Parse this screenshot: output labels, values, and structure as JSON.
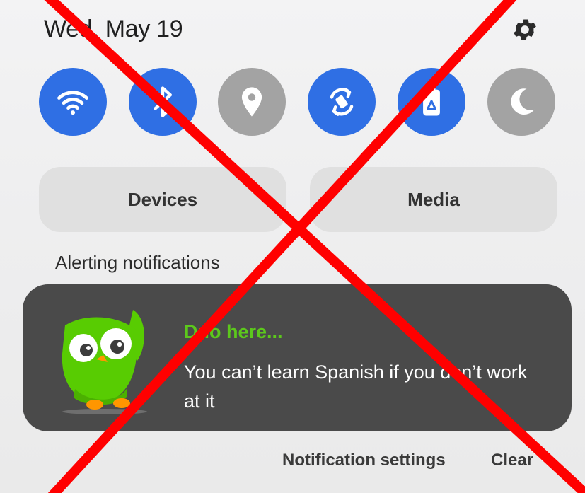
{
  "status": {
    "date": "Wed, May 19"
  },
  "quick_toggles": [
    {
      "icon": "wifi-icon",
      "state": "on"
    },
    {
      "icon": "bluetooth-icon",
      "state": "on"
    },
    {
      "icon": "location-icon",
      "state": "off"
    },
    {
      "icon": "auto-rotate-icon",
      "state": "on"
    },
    {
      "icon": "power-saving-icon",
      "state": "on"
    },
    {
      "icon": "dark-mode-icon",
      "state": "off"
    }
  ],
  "panels": {
    "devices": "Devices",
    "media": "Media"
  },
  "section_title": "Alerting notifications",
  "notification": {
    "app_icon": "duolingo-owl-icon",
    "title": "Duo here...",
    "body": "You can’t learn Spanish if you don’t work at it"
  },
  "footer": {
    "settings": "Notification settings",
    "clear": "Clear"
  },
  "colors": {
    "accent": "#2f6fe4",
    "inactive": "#a3a3a3",
    "notif_bg": "#4a4a4a",
    "notif_title": "#5cc81c",
    "overlay": "#ff0000"
  }
}
